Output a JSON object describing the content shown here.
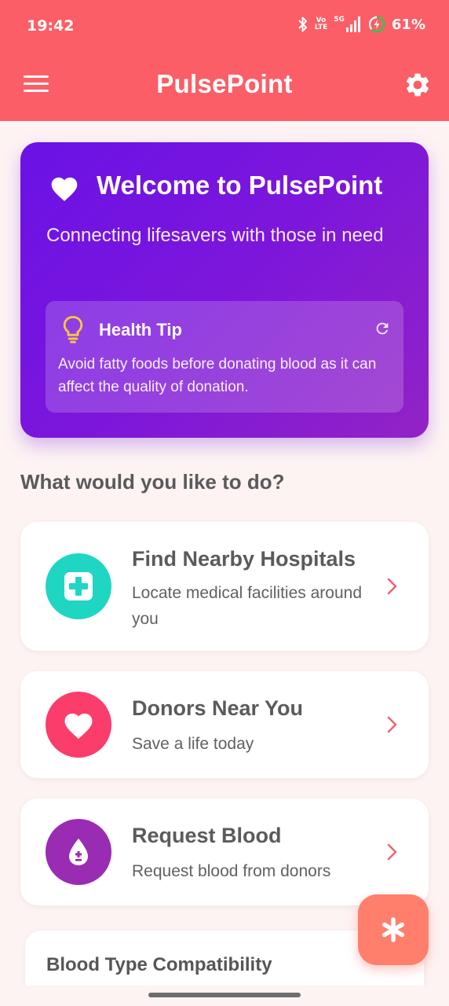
{
  "status_bar": {
    "time": "19:42",
    "volte_top": "Vo",
    "volte_bottom": "LTE",
    "network": "5G",
    "battery": "61%"
  },
  "app_bar": {
    "title": "PulsePoint",
    "icons": {
      "left": "menu-icon",
      "right": "gear-icon"
    }
  },
  "welcome": {
    "title": "Welcome to PulsePoint",
    "subtitle": "Connecting lifesavers with those in need",
    "tip": {
      "title": "Health Tip",
      "text": "Avoid fatty foods before donating blood as it can affect the quality of donation."
    }
  },
  "section_heading": "What would you like to do?",
  "actions": [
    {
      "title": "Find Nearby Hospitals",
      "subtitle": "Locate medical facilities around you",
      "icon": "medical-cross-icon",
      "color": "#1fd6c3"
    },
    {
      "title": "Donors Near You",
      "subtitle": "Save a life today",
      "icon": "heart-icon",
      "color": "#fb3d6c"
    },
    {
      "title": "Request Blood",
      "subtitle": "Request blood from donors",
      "icon": "blood-drop-icon",
      "color": "#9a2bb3"
    }
  ],
  "compatibility": {
    "title": "Blood Type Compatibility"
  },
  "fab": {
    "icon": "asterisk-icon",
    "color": "#ff7f6c"
  },
  "colors": {
    "primary": "#fb5e66",
    "welcome_gradient_start": "#6a12e6",
    "welcome_gradient_end": "#9223c6",
    "background": "#fdf3f3",
    "chevron": "#f06470"
  }
}
